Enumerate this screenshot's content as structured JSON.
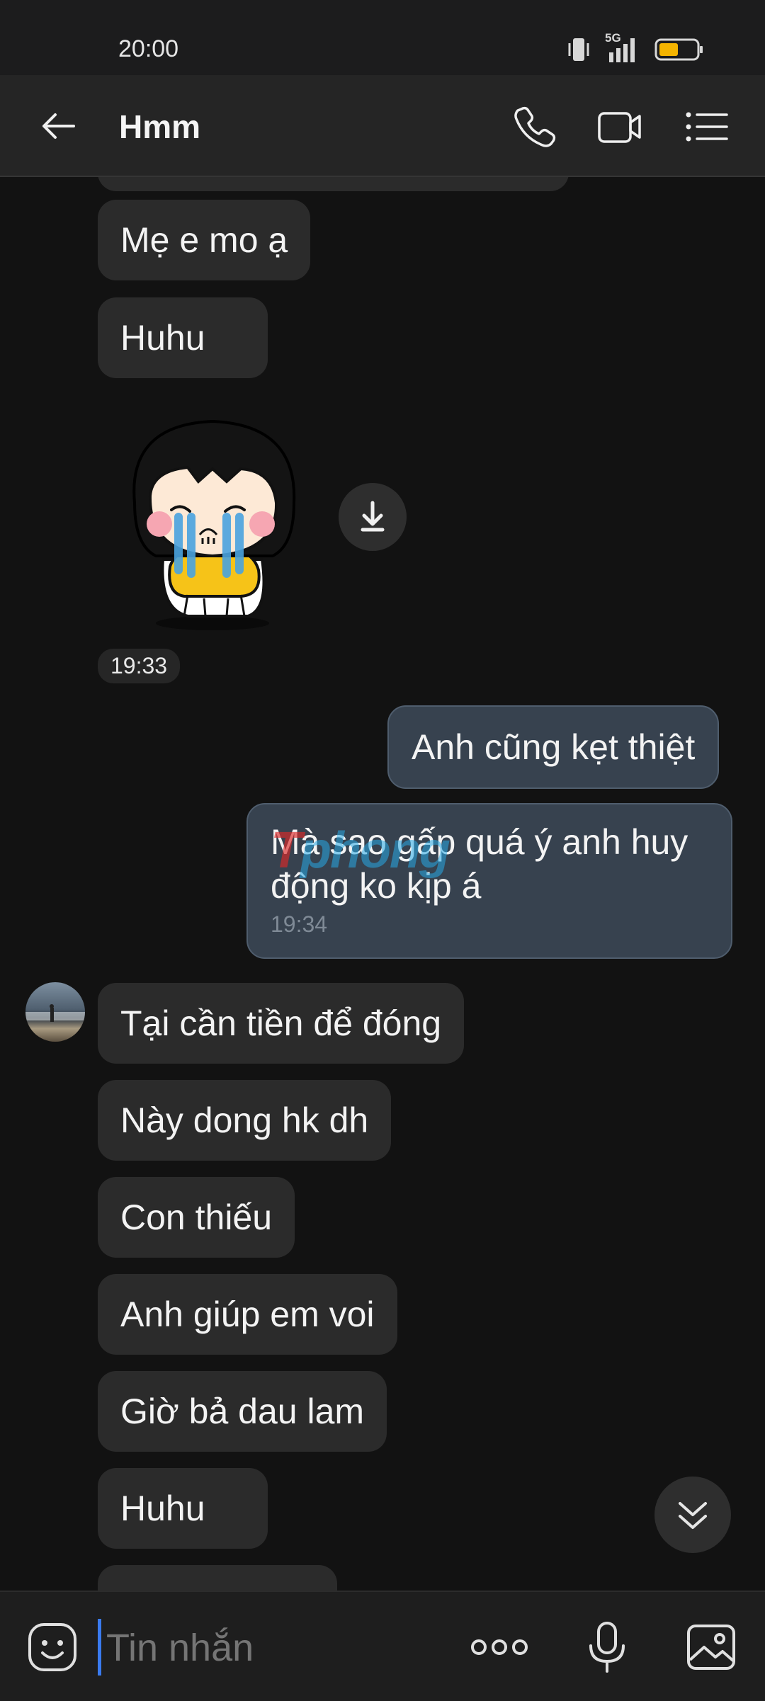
{
  "status_bar": {
    "time": "20:00",
    "network": "5G"
  },
  "header": {
    "title": "Hmm"
  },
  "messages": {
    "m1": "Mẹ e mo ạ",
    "m2": "Huhu",
    "ts1": "19:33",
    "o1": "Anh cũng kẹt thiệt",
    "o2_line1": "Mà sao gấp quá ý anh huy",
    "o2_line2": "động ko kịp á",
    "ts2": "19:34",
    "r1": "Tại cần tiền để đóng",
    "r2": "Này dong hk dh",
    "r3": "Con thiếu",
    "r4": "Anh giúp em voi",
    "r5": "Giờ bả dau lam",
    "r6": "Huhu"
  },
  "input": {
    "placeholder": "Tin nhắn"
  },
  "colors": {
    "accent": "#3a7bf0",
    "outgoing_bubble": "#37424f",
    "incoming_bubble": "#2b2b2b"
  }
}
